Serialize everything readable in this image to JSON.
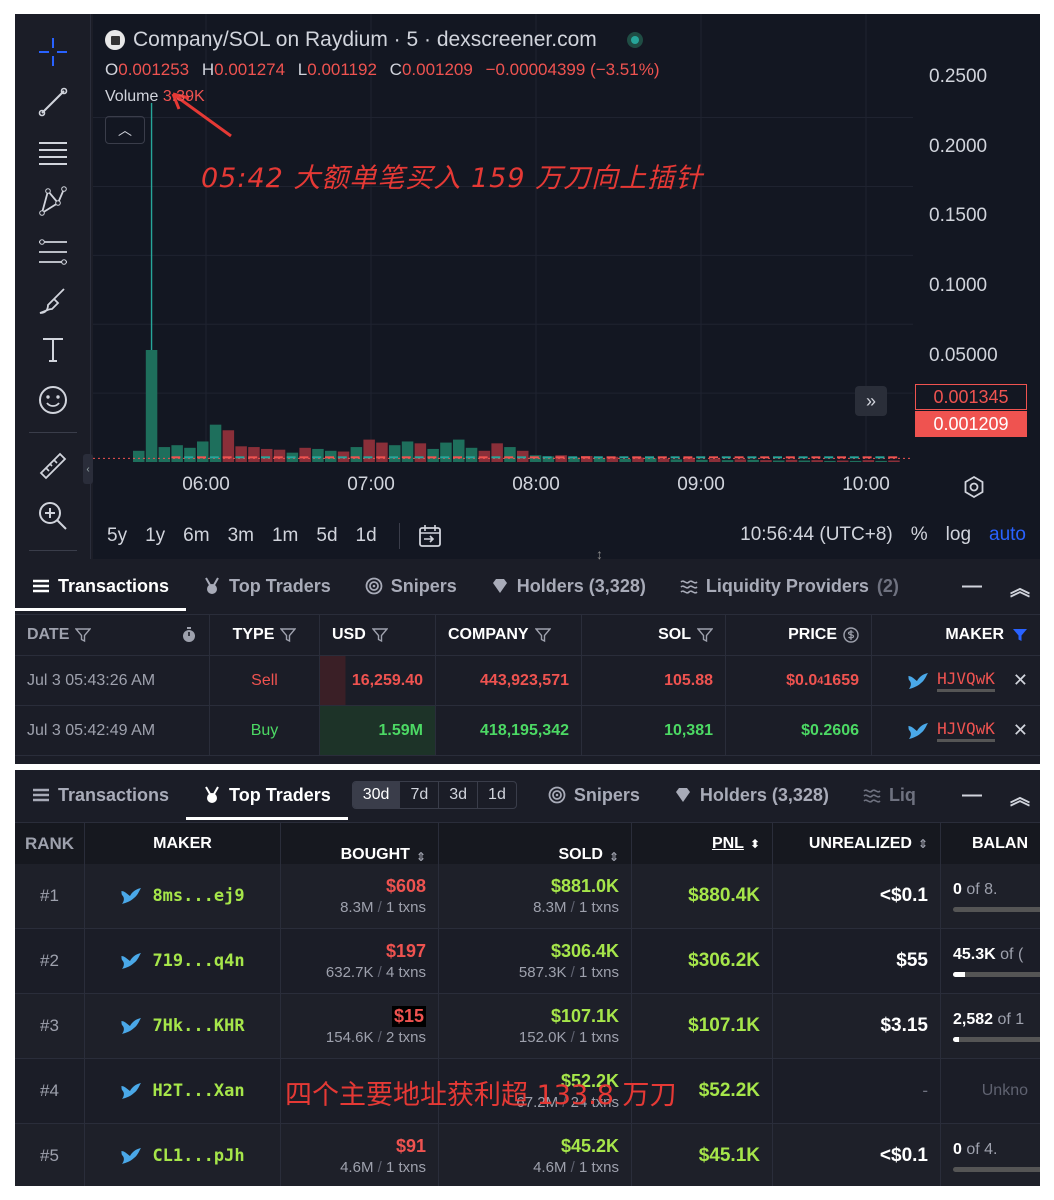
{
  "chart": {
    "title": "Company/SOL on Raydium · 5 · dexscreener.com",
    "ohlc": {
      "o_label": "O",
      "o": "0.001253",
      "h_label": "H",
      "h": "0.001274",
      "l_label": "L",
      "l": "0.001192",
      "c_label": "C",
      "c": "0.001209",
      "change": "−0.00004399 (−3.51%)"
    },
    "volume_label": "Volume",
    "volume_value": "3.39K",
    "annotation": "05:42 大额单笔买入 159 万刀向上插针",
    "y_ticks": [
      "0.2500",
      "0.2000",
      "0.1500",
      "0.1000",
      "0.05000"
    ],
    "price_prev": "0.001345",
    "price_last": "0.001209",
    "x_ticks": [
      "06:00",
      "07:00",
      "08:00",
      "09:00",
      "10:00"
    ],
    "ranges": [
      "5y",
      "1y",
      "6m",
      "3m",
      "1m",
      "5d",
      "1d"
    ],
    "clock": "10:56:44 (UTC+8)",
    "pct": "%",
    "log": "log",
    "auto": "auto",
    "colors": {
      "up": "#26a69a",
      "down": "#ef5350",
      "bg": "#131722"
    }
  },
  "chart_data": {
    "type": "bar",
    "title": "Company/SOL on Raydium · 5 · dexscreener.com",
    "x_ticks": [
      "06:00",
      "07:00",
      "08:00",
      "09:00",
      "10:00"
    ],
    "y_ticks": [
      0.25,
      0.2,
      0.15,
      0.1,
      0.05
    ],
    "ylim": [
      0,
      0.27
    ],
    "last_price": 0.001209,
    "spike": {
      "time": "05:42",
      "high": 0.2606
    },
    "volume_bars": [
      {
        "dir": "up",
        "v": 30
      },
      {
        "dir": "up",
        "v": 300
      },
      {
        "dir": "up",
        "v": 40
      },
      {
        "dir": "up",
        "v": 45
      },
      {
        "dir": "up",
        "v": 38
      },
      {
        "dir": "up",
        "v": 55
      },
      {
        "dir": "up",
        "v": 100
      },
      {
        "dir": "down",
        "v": 85
      },
      {
        "dir": "down",
        "v": 42
      },
      {
        "dir": "down",
        "v": 40
      },
      {
        "dir": "down",
        "v": 35
      },
      {
        "dir": "down",
        "v": 33
      },
      {
        "dir": "up",
        "v": 25
      },
      {
        "dir": "down",
        "v": 38
      },
      {
        "dir": "up",
        "v": 35
      },
      {
        "dir": "up",
        "v": 30
      },
      {
        "dir": "down",
        "v": 28
      },
      {
        "dir": "up",
        "v": 40
      },
      {
        "dir": "down",
        "v": 60
      },
      {
        "dir": "down",
        "v": 52
      },
      {
        "dir": "up",
        "v": 45
      },
      {
        "dir": "up",
        "v": 55
      },
      {
        "dir": "down",
        "v": 50
      },
      {
        "dir": "up",
        "v": 35
      },
      {
        "dir": "up",
        "v": 52
      },
      {
        "dir": "up",
        "v": 60
      },
      {
        "dir": "up",
        "v": 38
      },
      {
        "dir": "down",
        "v": 30
      },
      {
        "dir": "down",
        "v": 50
      },
      {
        "dir": "up",
        "v": 40
      },
      {
        "dir": "down",
        "v": 30
      },
      {
        "dir": "up",
        "v": 18
      },
      {
        "dir": "up",
        "v": 15
      },
      {
        "dir": "down",
        "v": 18
      },
      {
        "dir": "up",
        "v": 12
      },
      {
        "dir": "down",
        "v": 16
      },
      {
        "dir": "up",
        "v": 10
      },
      {
        "dir": "down",
        "v": 14
      },
      {
        "dir": "up",
        "v": 8
      },
      {
        "dir": "down",
        "v": 12
      },
      {
        "dir": "up",
        "v": 10
      },
      {
        "dir": "down",
        "v": 9
      },
      {
        "dir": "up",
        "v": 7
      },
      {
        "dir": "down",
        "v": 11
      },
      {
        "dir": "up",
        "v": 6
      },
      {
        "dir": "down",
        "v": 8
      },
      {
        "dir": "up",
        "v": 5
      },
      {
        "dir": "down",
        "v": 7
      },
      {
        "dir": "up",
        "v": 6
      },
      {
        "dir": "down",
        "v": 5
      },
      {
        "dir": "up",
        "v": 4
      },
      {
        "dir": "down",
        "v": 6
      },
      {
        "dir": "up",
        "v": 4
      },
      {
        "dir": "down",
        "v": 5
      },
      {
        "dir": "up",
        "v": 3
      },
      {
        "dir": "down",
        "v": 4
      },
      {
        "dir": "up",
        "v": 3
      },
      {
        "dir": "down",
        "v": 5
      },
      {
        "dir": "up",
        "v": 3
      },
      {
        "dir": "down",
        "v": 4
      }
    ]
  },
  "tabs1": {
    "transactions": "Transactions",
    "top_traders": "Top Traders",
    "snipers": "Snipers",
    "holders": "Holders (3,328)",
    "liquidity": "Liquidity Providers",
    "liquidity_count": "(2)"
  },
  "tx_table": {
    "headers": {
      "date": "DATE",
      "type": "TYPE",
      "usd": "USD",
      "company": "COMPANY",
      "sol": "SOL",
      "price": "PRICE",
      "maker": "MAKER"
    },
    "rows": [
      {
        "date": "Jul 3 05:43:26 AM",
        "type": "Sell",
        "usd": "16,259.40",
        "company": "443,923,571",
        "sol": "105.88",
        "price_a": "$0.0",
        "price_sub": "4",
        "price_b": "1659",
        "maker": "HJVQwK"
      },
      {
        "date": "Jul 3 05:42:49 AM",
        "type": "Buy",
        "usd": "1.59M",
        "company": "418,195,342",
        "sol": "10,381",
        "price_a": "$0.2606",
        "price_sub": "",
        "price_b": "",
        "maker": "HJVQwK"
      }
    ]
  },
  "tabs2": {
    "transactions": "Transactions",
    "top_traders": "Top Traders",
    "periods": [
      "30d",
      "7d",
      "3d",
      "1d"
    ],
    "snipers": "Snipers",
    "holders": "Holders (3,328)",
    "liq": "Liq"
  },
  "tt_table": {
    "headers": {
      "rank": "RANK",
      "maker": "MAKER",
      "bought": "BOUGHT",
      "sold": "SOLD",
      "pnl": "PNL",
      "unrealized": "UNREALIZED",
      "balance": "BALAN"
    },
    "rows": [
      {
        "rank": "#1",
        "maker": "8ms...ej9",
        "bought": "$608",
        "bought_tok": "8.3M",
        "bought_tx": "1 txns",
        "sold": "$881.0K",
        "sold_tok": "8.3M",
        "sold_tx": "1 txns",
        "pnl": "$880.4K",
        "unrealized": "<$0.1",
        "bal_amt": "0",
        "bal_of": "of 8.",
        "bal_frac": 0.0
      },
      {
        "rank": "#2",
        "maker": "719...q4n",
        "bought": "$197",
        "bought_tok": "632.7K",
        "bought_tx": "4 txns",
        "sold": "$306.4K",
        "sold_tok": "587.3K",
        "sold_tx": "1 txns",
        "pnl": "$306.2K",
        "unrealized": "$55",
        "bal_amt": "45.3K",
        "bal_of": "of (",
        "bal_frac": 0.1
      },
      {
        "rank": "#3",
        "maker": "7Hk...KHR",
        "bought": "$15",
        "bought_tok": "154.6K",
        "bought_tx": "2 txns",
        "sold": "$107.1K",
        "sold_tok": "152.0K",
        "sold_tx": "1 txns",
        "pnl": "$107.1K",
        "unrealized": "$3.15",
        "bal_amt": "2,582",
        "bal_of": "of 1",
        "bal_frac": 0.05
      },
      {
        "rank": "#4",
        "maker": "H2T...Xan",
        "bought": "",
        "bought_tok": "",
        "bought_tx": "",
        "sold": "$52.2K",
        "sold_tok": "67.2M",
        "sold_tx": "24 txns",
        "pnl": "$52.2K",
        "unrealized": "-",
        "bal_unknown": "Unkno"
      },
      {
        "rank": "#5",
        "maker": "CL1...pJh",
        "bought": "$91",
        "bought_tok": "4.6M",
        "bought_tx": "1 txns",
        "sold": "$45.2K",
        "sold_tok": "4.6M",
        "sold_tx": "1 txns",
        "pnl": "$45.1K",
        "unrealized": "<$0.1",
        "bal_amt": "0",
        "bal_of": "of 4.",
        "bal_frac": 0.0
      }
    ],
    "annotation": "四个主要地址获利超 133.8 万刀"
  }
}
